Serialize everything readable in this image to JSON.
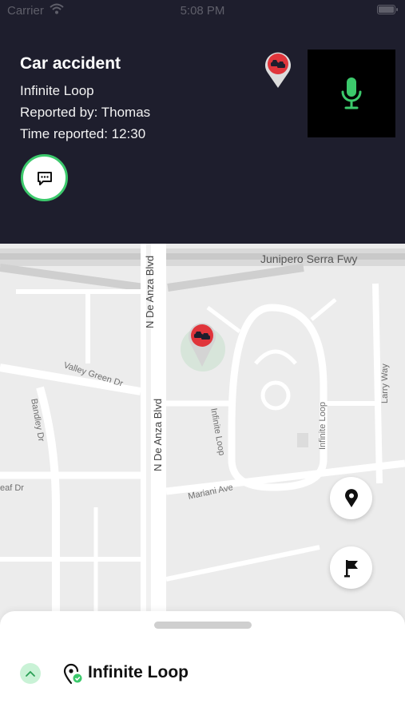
{
  "status_bar": {
    "carrier": "Carrier",
    "time": "5:08 PM"
  },
  "incident": {
    "title": "Car accident",
    "location": "Infinite Loop",
    "reported_by": "Reported by: Thomas",
    "time_reported": "Time reported: 12:30",
    "icons": {
      "chat": "chat-bubble-icon",
      "marker": "car-accident-pin-icon",
      "mic": "microphone-icon"
    }
  },
  "map": {
    "labels": {
      "junipero": "Junipero Serra Fwy",
      "de_anza_top": "N De Anza Blvd",
      "de_anza_mid": "N De Anza Blvd",
      "valley_green": "Valley Green Dr",
      "bandley": "Bandley Dr",
      "infinite_loop_1": "Infinite Loop",
      "infinite_loop_2": "Infinite Loop",
      "larry_way": "Larry Way",
      "mariani": "Mariani Ave",
      "eaf": "eaf Dr"
    },
    "buttons": {
      "location_icon": "map-pin-icon",
      "flag_icon": "flag-icon"
    }
  },
  "sheet": {
    "title": "Infinite Loop",
    "toggle_icon": "chevron-up-icon",
    "place_icon": "place-check-icon"
  },
  "colors": {
    "header_bg": "#1e1e2d",
    "accent_green": "#3cc96c",
    "marker_red": "#e0353b"
  }
}
